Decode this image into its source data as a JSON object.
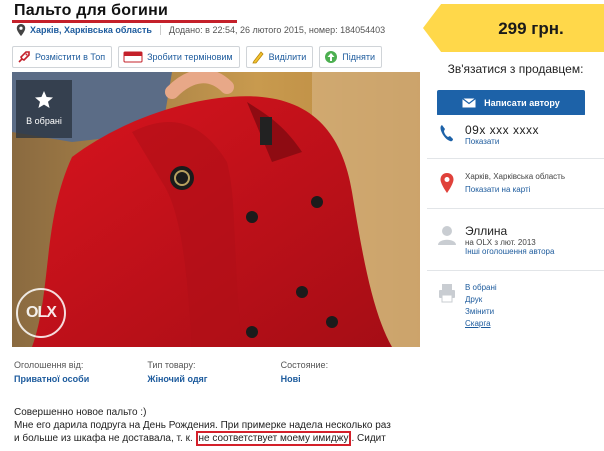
{
  "listing": {
    "title": "Пальто для богини",
    "location": "Харків, Харківська область",
    "meta": "Додано: в 22:54, 26 лютого 2015, номер: 184054403",
    "price": "299 грн."
  },
  "actions": [
    {
      "label": "Розмістити в Топ",
      "icon": "rocket-icon"
    },
    {
      "label": "Зробити терміновим",
      "icon": "urgent-icon"
    },
    {
      "label": "Виділити",
      "icon": "highlight-icon"
    },
    {
      "label": "Підняти",
      "icon": "up-icon"
    }
  ],
  "photo": {
    "favorite_label": "В обрані",
    "watermark": "OLX"
  },
  "details": [
    {
      "label": "Оголошення від:",
      "value": "Приватної особи"
    },
    {
      "label": "Тип товару:",
      "value": "Жіночий одяг"
    },
    {
      "label": "Состояние:",
      "value": "Нові"
    }
  ],
  "description": {
    "line1": "Совершенно новое пальто :)",
    "line2": "Мне его дарила подруга на День Рождения. При примерке надела несколько раз",
    "line3_start": "и больше из шкафа не доставала, т. к. ",
    "line3_highlight": "не соответствует моему имиджу",
    "line3_end": ". Сидит"
  },
  "sidebar": {
    "contact_title": "Зв'язатися з продавцем:",
    "message_button": "Написати автору",
    "phone": "09x xxx xxxx",
    "phone_show": "Показати",
    "location": "Харків, Харківська область",
    "map_link": "Показати на карті",
    "seller_name": "Эллина",
    "seller_since": "на OLX з лют. 2013",
    "other_ads": "Інші оголошення автора",
    "links": [
      "В обрані",
      "Друк",
      "Змінити",
      "Скарга"
    ]
  },
  "colors": {
    "accent": "#1d62a8",
    "price_bg": "#ffd84a",
    "highlight": "#d4202a",
    "link": "#1d5b9d"
  }
}
